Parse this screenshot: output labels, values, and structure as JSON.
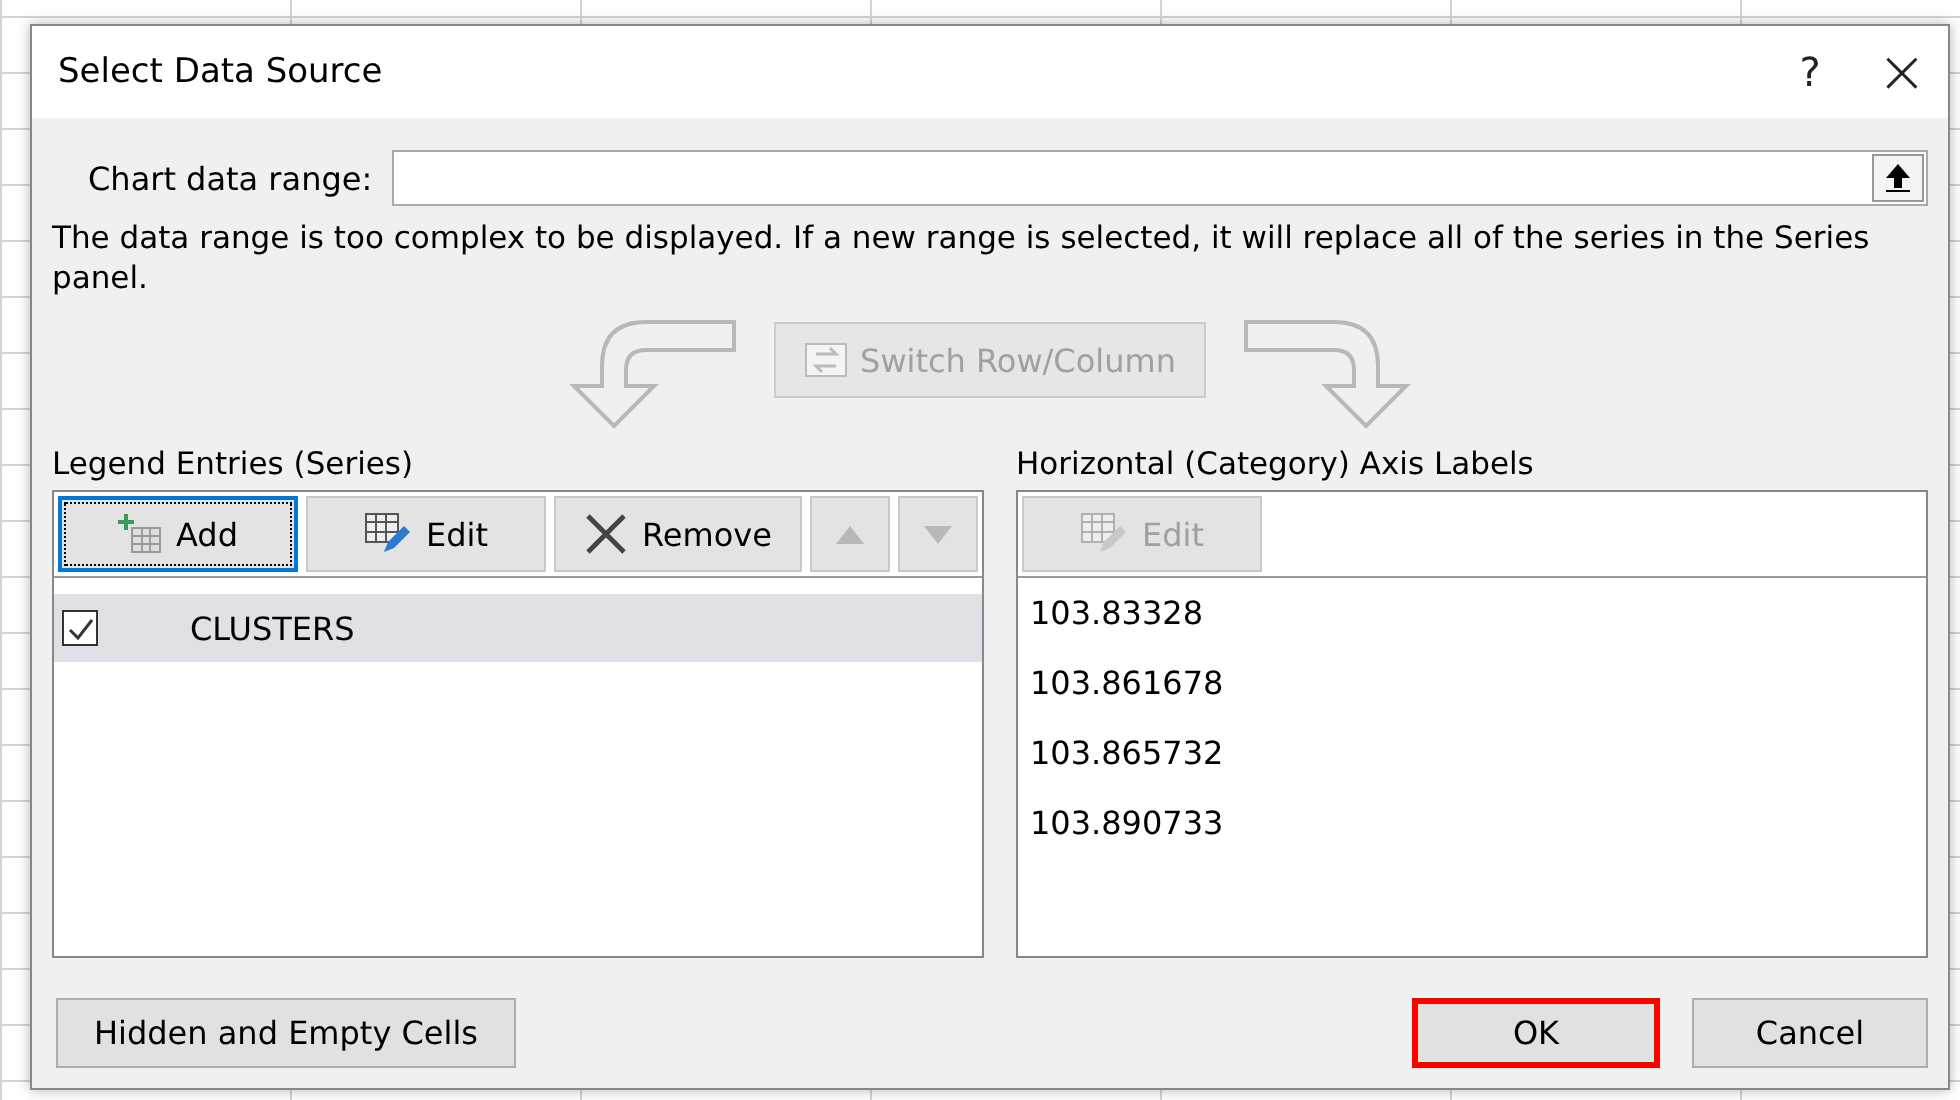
{
  "dialog": {
    "title": "Select Data Source",
    "help": "?",
    "close": "×"
  },
  "range": {
    "label": "Chart data range:"
  },
  "message": "The data range is too complex to be displayed. If a new range is selected, it will replace all of the series in the Series panel.",
  "switch_button": {
    "label": "Switch Row/Column",
    "disabled": true
  },
  "series_panel": {
    "title": "Legend Entries (Series)",
    "buttons": [
      {
        "kind": "add",
        "label": "Add",
        "focused": true,
        "disabled": false
      },
      {
        "kind": "edit",
        "label": "Edit",
        "focused": false,
        "disabled": false
      },
      {
        "kind": "remove",
        "label": "Remove",
        "focused": false,
        "disabled": false
      },
      {
        "kind": "up",
        "focused": false,
        "disabled": true
      },
      {
        "kind": "down",
        "focused": false,
        "disabled": true
      }
    ],
    "items": [
      {
        "label": "CLUSTERS",
        "checked": true,
        "selected": true
      }
    ]
  },
  "axis_panel": {
    "title": "Horizontal (Category) Axis Labels",
    "edit_button": {
      "label": "Edit",
      "disabled": true
    },
    "items": [
      "103.83328",
      "103.861678",
      "103.865732",
      "103.890733"
    ]
  },
  "footer": {
    "hidden_cells_button": "Hidden and Empty Cells",
    "ok": {
      "label": "OK",
      "highlighted": true
    },
    "cancel": "Cancel"
  }
}
